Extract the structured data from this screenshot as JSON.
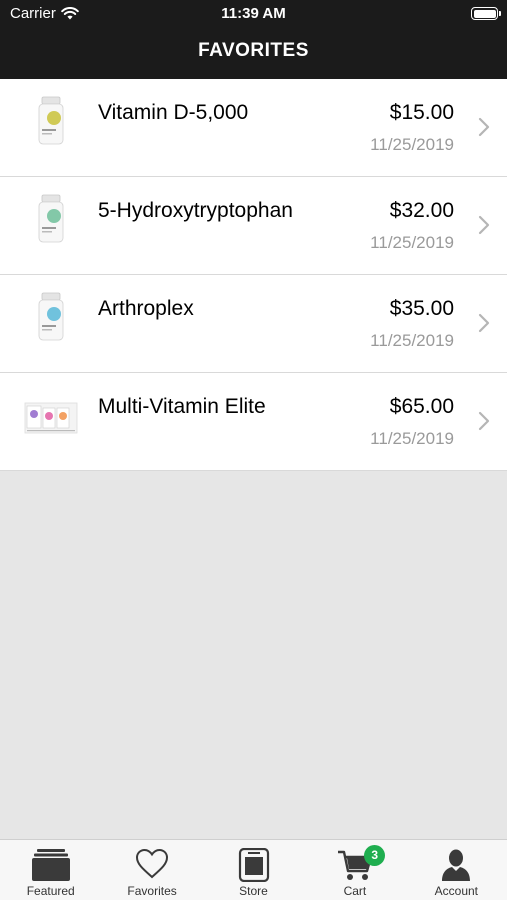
{
  "status_bar": {
    "carrier": "Carrier",
    "time": "11:39 AM"
  },
  "nav": {
    "title": "FAVORITES"
  },
  "favorites": [
    {
      "name": "Vitamin D-5,000",
      "price": "$15.00",
      "date": "11/25/2019",
      "accent": "#c9c23a"
    },
    {
      "name": "5-Hydroxytryptophan",
      "price": "$32.00",
      "date": "11/25/2019",
      "accent": "#6fbf9a"
    },
    {
      "name": "Arthroplex",
      "price": "$35.00",
      "date": "11/25/2019",
      "accent": "#58b8d8"
    },
    {
      "name": "Multi-Vitamin Elite",
      "price": "$65.00",
      "date": "11/25/2019",
      "accent": "#e0529c"
    }
  ],
  "tabs": [
    {
      "label": "Featured",
      "icon": "featured-icon"
    },
    {
      "label": "Favorites",
      "icon": "heart-icon"
    },
    {
      "label": "Store",
      "icon": "store-icon"
    },
    {
      "label": "Cart",
      "icon": "cart-icon",
      "badge": "3"
    },
    {
      "label": "Account",
      "icon": "account-icon"
    }
  ],
  "colors": {
    "header_bg": "#1b1b1b",
    "badge": "#1fae4f",
    "page_bg": "#e6e6e6"
  }
}
